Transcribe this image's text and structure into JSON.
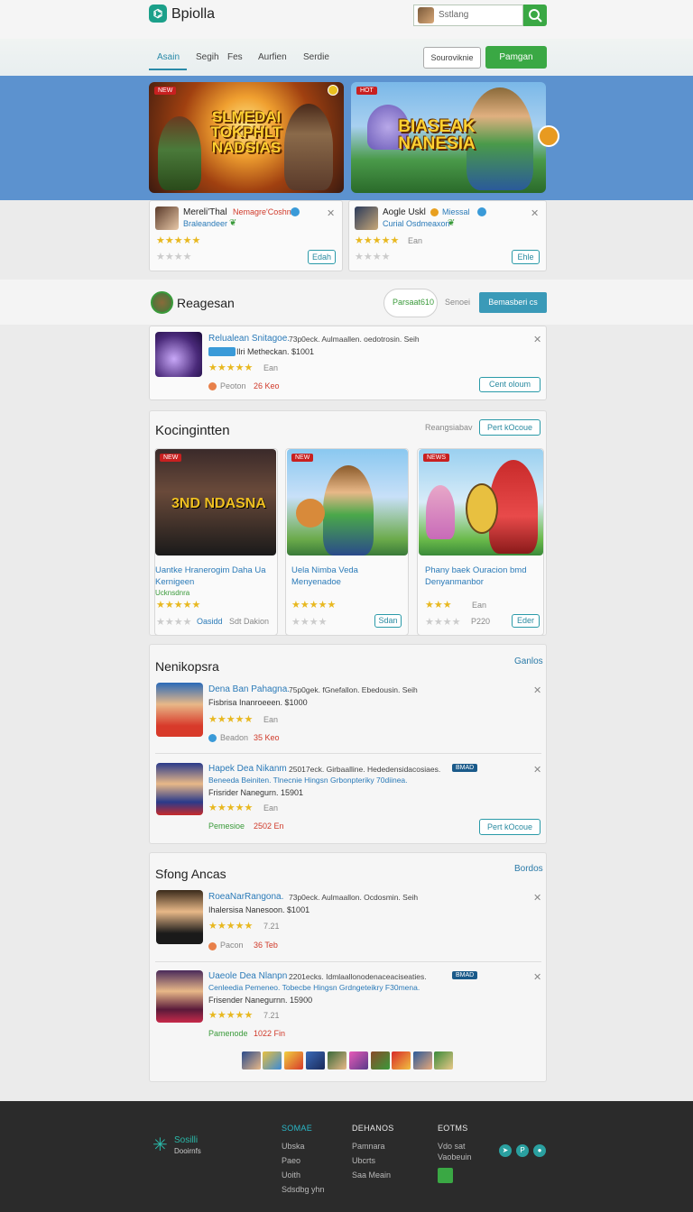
{
  "header": {
    "logo_icon": "logo-icon",
    "logo_text": "Bpiolla",
    "search_placeholder": "Sstlang",
    "search_icon": "search-icon"
  },
  "nav": {
    "tabs": [
      "Asain",
      "Segih",
      "Fes",
      "Aurfien",
      "Serdie"
    ],
    "active_tab": 0,
    "outline_button": "Souroviknie",
    "green_button": "Pamgan"
  },
  "banners": [
    {
      "tag": "NEW",
      "title": "SLMEDAI\nTOKPHLT\nNADSIAS",
      "color": "#ffd030"
    },
    {
      "tag": "HOT",
      "title": "BIASEAK\nNANESIA",
      "color": "#ffd030"
    }
  ],
  "featured_cards": [
    {
      "name": "Mereli'Thal",
      "tag": "Nemagre'Coshns",
      "sub": "Braleandeer",
      "button": "Edah"
    },
    {
      "name": "Aogle Uskl",
      "tag": "Miessal",
      "sub": "Curial Osdmeaxon",
      "rating_text": "Ean",
      "button": "Ehle"
    }
  ],
  "regesan": {
    "title": "Reagesan",
    "pill_text": "Parsaat610",
    "link": "Senoei",
    "button": "Bemasberi cs",
    "item": {
      "title": "Relualean Snitagoe.",
      "meta": "73p0eck. Aulmaallen. oedotrosin. Seih",
      "sub": "Ilri Metheckan.  $1001",
      "rating_text": "Ean",
      "status": "Peoton",
      "status2": "26 Keo",
      "button": "Cent oloum"
    }
  },
  "kocingintten": {
    "title": "Kocingintten",
    "link": "Reangsiabav",
    "button": "Pert kOcoue",
    "items": [
      {
        "tag": "NEW",
        "overlay": "3ND NDASNA",
        "title": "Uantke Hranerogim Daha Ua Kernigeen",
        "sub": "Ucknsdnra",
        "foot_left": "Oasidd",
        "foot_right": "Sdt Dakion"
      },
      {
        "tag": "NEW",
        "overlay": "",
        "title": "Uela Nimba Veda Menyenadoe",
        "sub": "",
        "foot_left": "",
        "foot_right": "Sdan"
      },
      {
        "tag": "NEWS",
        "overlay": "",
        "title": "Phany baek Ouracion bmd Denyanmanbor",
        "sub": "Ean",
        "foot_left": "P220",
        "foot_right": "Eder"
      }
    ]
  },
  "neniko": {
    "title": "Nenikopsra",
    "link_top": "Ganlos",
    "items": [
      {
        "title": "Dena Ban Pahagna.",
        "meta": "75p0gek. fGnefallon. Ebedousin. Seih",
        "sub": "Fisbrisa Inanroeeen.  $1000",
        "rating_text": "Ean",
        "status": "Beadon",
        "status2": "35 Keo",
        "badge": ""
      },
      {
        "title": "Hapek Dea Nikanm",
        "meta": "25017eck. Girbaalline. Hededensidacosiaes.",
        "line2": "Beneeda Beiniten. Tlnecnie Hingsn Grbonpteriky 70diinea.",
        "sub": "Frisrider Nanegurn.  15901",
        "rating_text": "Ean",
        "status": "Pemesioe",
        "status2": "2502 En",
        "badge": "BMAD",
        "button": "Pert kOcoue"
      }
    ]
  },
  "sfong": {
    "title": "Sfong Ancas",
    "link_top": "Bordos",
    "items": [
      {
        "title": "RoeaNarRangona.",
        "meta": "73p0eck. Aulmaallon. Ocdosmin. Seih",
        "sub": "Ihalersisa Nanesoon.  $1001",
        "rating_text": "7.21",
        "status": "Pacon",
        "status2": "36 Teb",
        "badge": ""
      },
      {
        "title": "Uaeole Dea Nlanpn",
        "meta": "2201ecks. Idmlaallonodenaceaciseaties.",
        "line2": "Cenleedia Pemeneo. Tobecbe Hingsn Grdngeteikry F30mena.",
        "sub": "Frisender Nanegurnn.  15900",
        "rating_text": "7.21",
        "status": "Pamenode",
        "status2": "1022 Fin",
        "badge": "BMAD"
      }
    ]
  },
  "footer": {
    "brand": "Sosilli",
    "brand_sub": "Dooirnfs",
    "col1_head": "SOMAE",
    "col1": [
      "Ubska",
      "Paeo",
      "Uoith",
      "Sdsdbg yhn"
    ],
    "col2_head": "DEHANOS",
    "col2": [
      "Pamnara",
      "Ubcrts",
      "Saa Meain"
    ],
    "col3_head": "EOTMS",
    "col3": [
      "Vdo sat",
      "Vaobeuin"
    ]
  },
  "colors": {
    "accent": "#2a8aa8",
    "green": "#3aa844",
    "hero_band": "#5c92cf",
    "footer": "#2b2b2b"
  }
}
